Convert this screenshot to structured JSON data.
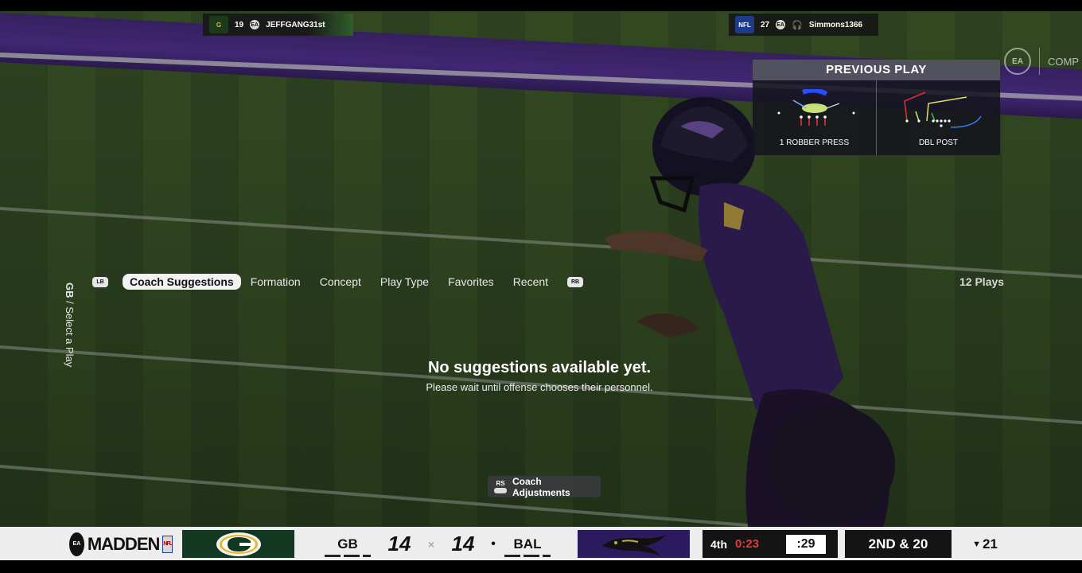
{
  "hud": {
    "away_chip": {
      "number": "19",
      "name": "JEFFGANG31st",
      "logo_text": ""
    },
    "home_chip": {
      "number": "27",
      "name": "Simmons1366"
    },
    "mode_label": "COMP",
    "ea_label": "EA"
  },
  "previous_play": {
    "title": "PREVIOUS PLAY",
    "defense_play": "1 ROBBER PRESS",
    "offense_play": "DBL POST"
  },
  "side_menu": {
    "team": "GB",
    "separator": " / ",
    "label": "Select a Play"
  },
  "tabs": {
    "left_bumper": "LB",
    "right_bumper": "RB",
    "items": [
      "Coach Suggestions",
      "Formation",
      "Concept",
      "Play Type",
      "Favorites",
      "Recent"
    ],
    "plays_count": "12 Plays"
  },
  "empty_state": {
    "title": "No suggestions available yet.",
    "subtitle": "Please wait until offense chooses their personnel."
  },
  "coach_adjustments": {
    "stick": "RS",
    "label": "Coach Adjustments"
  },
  "scorebug": {
    "brand": "MADDEN",
    "away_team": "GB",
    "away_score": "14",
    "home_team": "BAL",
    "home_score": "14",
    "vs": "×",
    "possession_marker": "•",
    "quarter": "4th",
    "game_clock": "0:23",
    "play_clock": ":29",
    "down_distance": "2ND & 20",
    "ball_on": "21",
    "ball_side_marker": "▼"
  },
  "colors": {
    "purple_band": "#4b2e83",
    "turf": "#3e5a2c",
    "game_clock": "#e23b3b",
    "gb_green": "#123822",
    "bal_purple": "#2b1a5e"
  }
}
